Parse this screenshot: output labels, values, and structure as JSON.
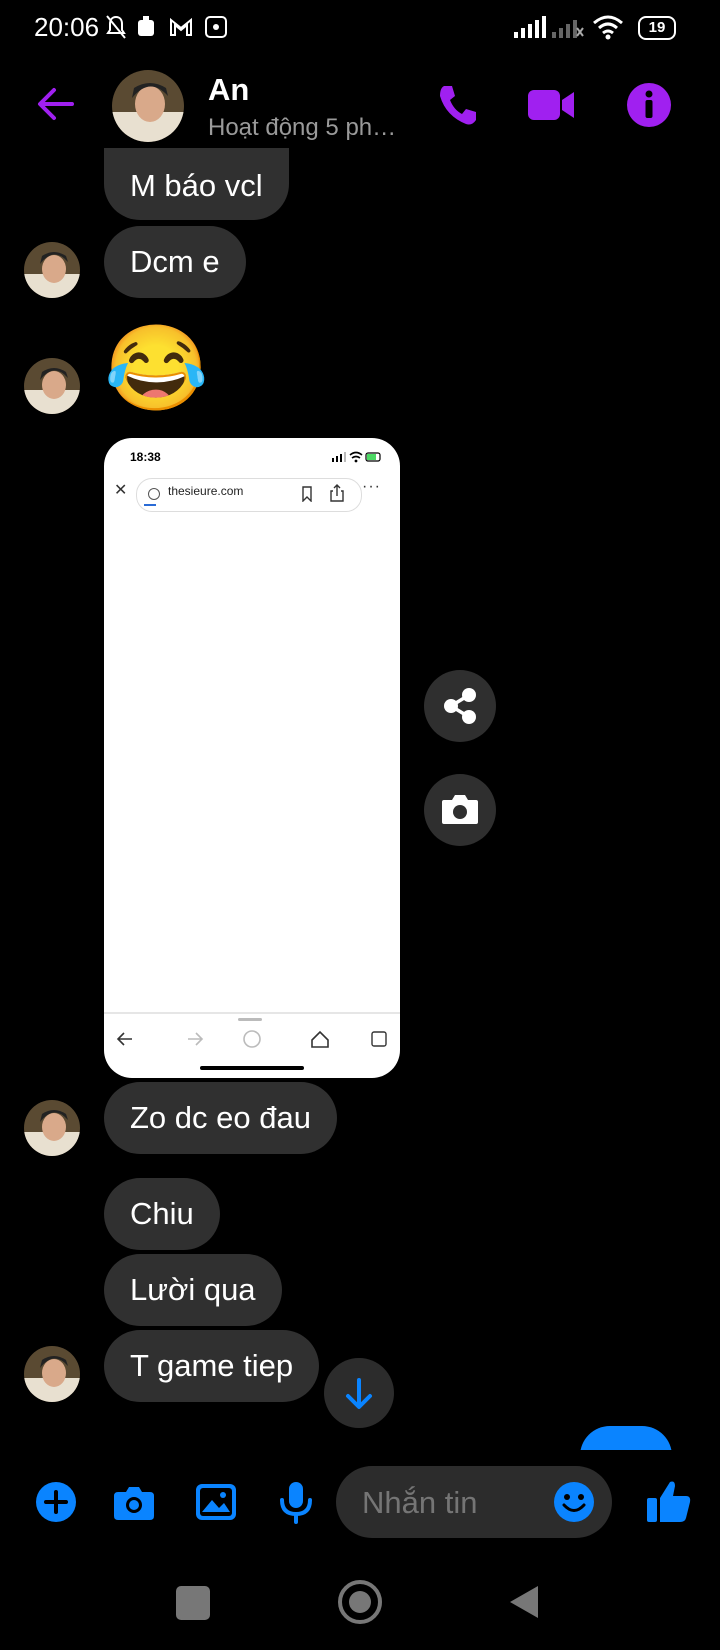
{
  "status_bar": {
    "time": "20:06",
    "battery": "19"
  },
  "header": {
    "name": "An",
    "status": "Hoạt động 5 phút..."
  },
  "messages": [
    {
      "text": "M báo vcl"
    },
    {
      "text": "Dcm e"
    },
    {
      "emoji": "😂"
    },
    {
      "text": "Zo dc eo đau"
    },
    {
      "text": "Chiu"
    },
    {
      "text": "Lười qua"
    },
    {
      "text": "T game tiep"
    }
  ],
  "shared_screenshot": {
    "time": "18:38",
    "url": "thesieure.com"
  },
  "composer": {
    "placeholder": "Nhắn tin"
  },
  "colors": {
    "accent": "#a020f0",
    "blue": "#0a84ff",
    "bubble": "#303030"
  },
  "icons": [
    "back-arrow-icon",
    "phone-icon",
    "video-icon",
    "info-icon",
    "share-icon",
    "camera-icon",
    "arrow-down-icon",
    "plus-icon",
    "image-icon",
    "mic-icon",
    "emoji-icon",
    "like-icon"
  ]
}
